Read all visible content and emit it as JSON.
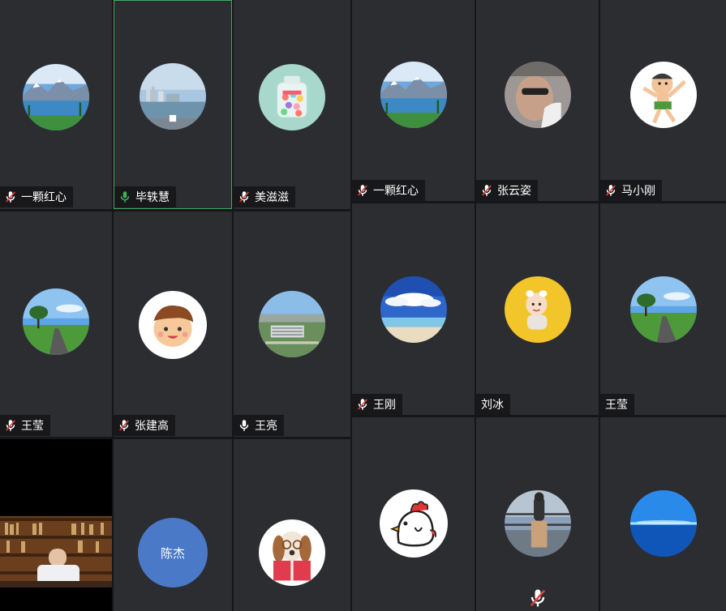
{
  "colors": {
    "tile_bg": "#2c2d31",
    "active_border": "#3fae5a",
    "mic_on": "#3fae5a",
    "mic_off_slash": "#e04040",
    "initials_avatar": "#4a79c8"
  },
  "left_grid": [
    {
      "name": "一颗红心",
      "mic": "muted",
      "avatar": "lake-mountain-photo",
      "active": false
    },
    {
      "name": "毕轶慧",
      "mic": "speaking",
      "avatar": "city-river-photo",
      "active": true
    },
    {
      "name": "美滋滋",
      "mic": "muted",
      "avatar": "candy-jar-photo",
      "active": false
    },
    {
      "name": "王莹",
      "mic": "muted",
      "avatar": "tree-road-photo",
      "active": false
    },
    {
      "name": "张建高",
      "mic": "muted",
      "avatar": "cartoon-boy-face",
      "active": false
    },
    {
      "name": "王亮",
      "mic": "on",
      "avatar": "campus-aerial-photo",
      "active": false
    },
    {
      "name": "",
      "mic": "none",
      "avatar": "video-library-room",
      "active": false
    },
    {
      "name": "",
      "mic": "none",
      "avatar_initials": "陈杰",
      "active": false
    },
    {
      "name": "",
      "mic": "none",
      "avatar": "dog-reading-book",
      "active": false
    }
  ],
  "right_grid": [
    {
      "name": "一颗红心",
      "mic": "muted",
      "avatar": "lake-mountain-photo"
    },
    {
      "name": "张云姿",
      "mic": "muted",
      "avatar": "man-sunglasses-photo"
    },
    {
      "name": "马小刚",
      "mic": "muted",
      "avatar": "cartoon-boy-cape"
    },
    {
      "name": "王刚",
      "mic": "muted",
      "avatar": "sky-clouds-photo"
    },
    {
      "name": "刘冰",
      "mic": "none",
      "avatar": "baby-yellow-photo"
    },
    {
      "name": "王莹",
      "mic": "none",
      "avatar": "tree-road-photo"
    },
    {
      "name": "",
      "mic": "none",
      "avatar": "cartoon-chicken"
    },
    {
      "name": "",
      "mic": "muted-floating",
      "avatar": "man-railing-photo"
    },
    {
      "name": "",
      "mic": "none",
      "avatar": "blue-ocean-photo"
    }
  ]
}
